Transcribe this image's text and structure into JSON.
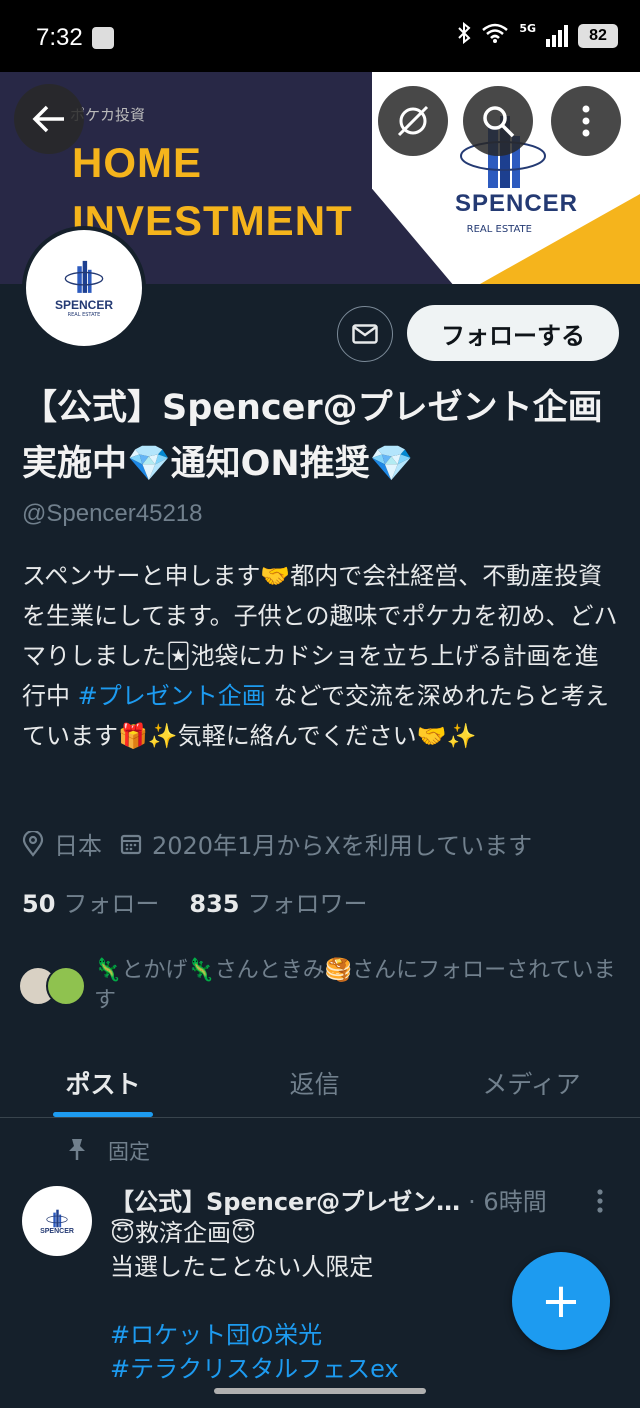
{
  "status_bar": {
    "time": "7:32",
    "network": "5G",
    "battery": "82"
  },
  "banner": {
    "small_text": "ポケカ投資",
    "headline_line1": "HOME",
    "headline_line2": "INVESTMENT",
    "logo_name": "SPENCER",
    "logo_sub": "REAL ESTATE"
  },
  "avatar": {
    "logo_name": "SPENCER",
    "logo_sub": "REAL ESTATE"
  },
  "profile": {
    "follow_label": "フォローする",
    "display_name": "【公式】Spencer@プレゼント企画実施中💎通知ON推奨💎",
    "handle": "@Spencer45218",
    "bio_part1": "スペンサーと申します🤝都内で会社経営、不動産投資を生業にしてます。子供との趣味でポケカを初め、どハマりしました🃏池袋にカドショを立ち上げる計画を進行中 ",
    "bio_hashtag": "#プレゼント企画",
    "bio_part2": " などで交流を深めれたらと考えています🎁✨気軽に絡んでください🤝✨",
    "location": "日本",
    "joined": "2020年1月からXを利用しています",
    "following_count": "50",
    "following_label": "フォロー",
    "followers_count": "835",
    "followers_label": "フォロワー",
    "followed_by": "🦎とかげ🦎さんときみ🥞さんにフォローされています"
  },
  "tabs": [
    {
      "label": "ポスト",
      "active": true
    },
    {
      "label": "返信",
      "active": false
    },
    {
      "label": "メディア",
      "active": false
    }
  ],
  "pinned_post": {
    "pinned_label": "固定",
    "author": "【公式】Spencer@プレゼン…",
    "time": "· 6時間",
    "line1": "😇救済企画😇",
    "line2": "当選したことない人限定",
    "hashtag1": "#ロケット団の栄光",
    "hashtag2": "#テラクリスタルフェスex",
    "avatar_logo": "SPENCER"
  },
  "fab_label": "+",
  "colors": {
    "background": "#15202b",
    "accent": "#1d9bf0",
    "banner_yellow": "#f5b41c",
    "muted": "#71808d"
  }
}
